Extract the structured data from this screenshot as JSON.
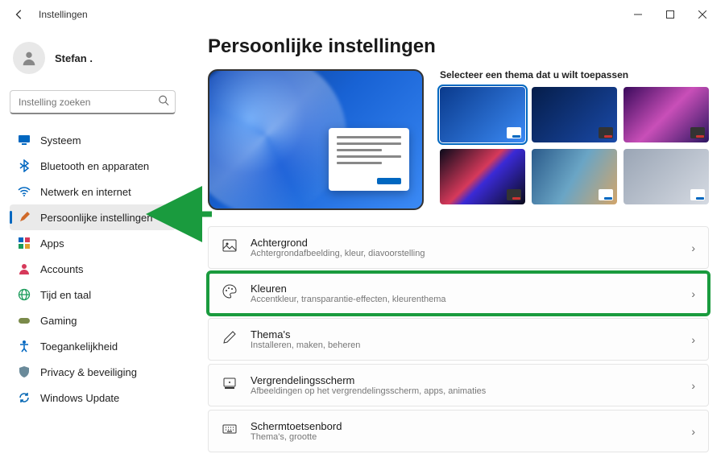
{
  "window": {
    "title": "Instellingen"
  },
  "user": {
    "name": "Stefan ."
  },
  "search": {
    "placeholder": "Instelling zoeken"
  },
  "sidebar": {
    "items": [
      {
        "label": "Systeem",
        "icon": "monitor",
        "color": "#0067c0"
      },
      {
        "label": "Bluetooth en apparaten",
        "icon": "bluetooth",
        "color": "#0067c0"
      },
      {
        "label": "Netwerk en internet",
        "icon": "wifi",
        "color": "#0067c0"
      },
      {
        "label": "Persoonlijke instellingen",
        "icon": "brush",
        "color": "#d06a2a",
        "selected": true
      },
      {
        "label": "Apps",
        "icon": "apps",
        "color": "#0067c0"
      },
      {
        "label": "Accounts",
        "icon": "person",
        "color": "#d6395a"
      },
      {
        "label": "Tijd en taal",
        "icon": "globe",
        "color": "#1a9b5a"
      },
      {
        "label": "Gaming",
        "icon": "gamepad",
        "color": "#5a7a3a"
      },
      {
        "label": "Toegankelijkheid",
        "icon": "accessibility",
        "color": "#0067c0"
      },
      {
        "label": "Privacy & beveiliging",
        "icon": "shield",
        "color": "#5a7a8a"
      },
      {
        "label": "Windows Update",
        "icon": "update",
        "color": "#0a6ab5"
      }
    ]
  },
  "page": {
    "title": "Persoonlijke instellingen",
    "themes_heading": "Selecteer een thema dat u wilt toepassen"
  },
  "settings": [
    {
      "title": "Achtergrond",
      "sub": "Achtergrondafbeelding, kleur, diavoorstelling",
      "icon": "image"
    },
    {
      "title": "Kleuren",
      "sub": "Accentkleur, transparantie-effecten, kleurenthema",
      "icon": "palette",
      "highlighted": true
    },
    {
      "title": "Thema's",
      "sub": "Installeren, maken, beheren",
      "icon": "pencil"
    },
    {
      "title": "Vergrendelingsscherm",
      "sub": "Afbeeldingen op het vergrendelingsscherm, apps, animaties",
      "icon": "lock"
    },
    {
      "title": "Schermtoetsenbord",
      "sub": "Thema's, grootte",
      "icon": "keyboard"
    }
  ]
}
